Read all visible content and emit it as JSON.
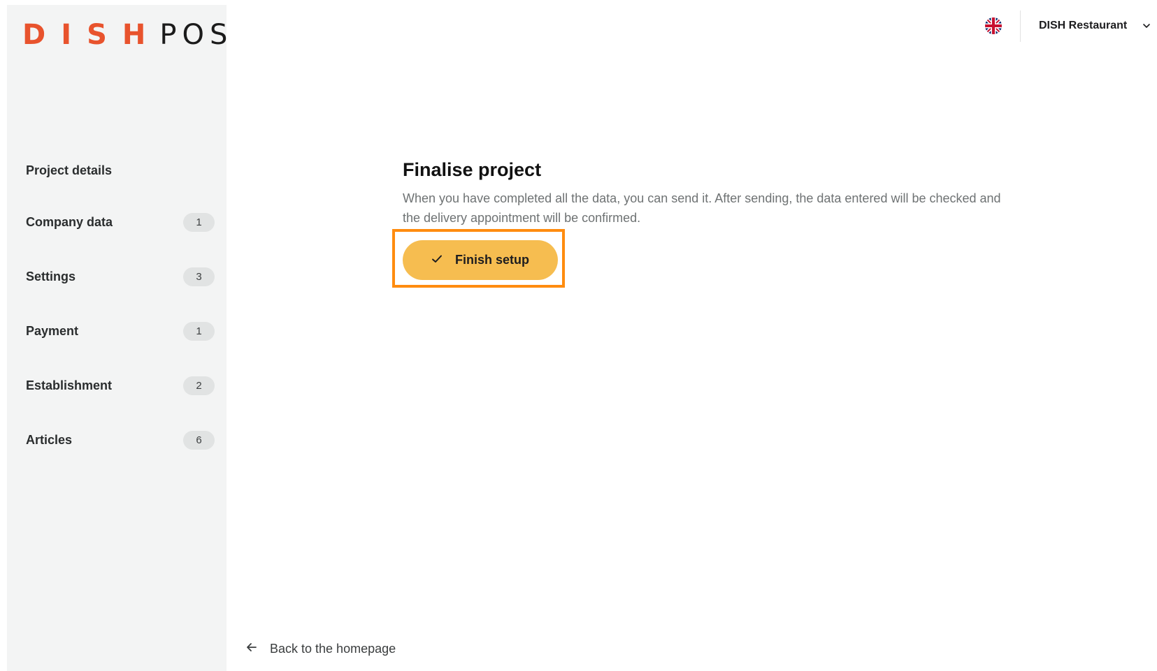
{
  "sidebar": {
    "logo": {
      "brand": "DISH",
      "product": "POS",
      "brand_color": "#e8532d"
    },
    "items": [
      {
        "label": "Project details",
        "badge": null
      },
      {
        "label": "Company data",
        "badge": "1"
      },
      {
        "label": "Settings",
        "badge": "3"
      },
      {
        "label": "Payment",
        "badge": "1"
      },
      {
        "label": "Establishment",
        "badge": "2"
      },
      {
        "label": "Articles",
        "badge": "6"
      }
    ]
  },
  "topbar": {
    "language_icon": "uk-flag-icon",
    "account_name": "DISH Restaurant",
    "account_icon": "chevron-down-icon"
  },
  "main": {
    "title": "Finalise project",
    "description": "When you have completed all the data, you can send it. After sending, the data entered will be checked and the delivery appointment will be confirmed.",
    "finish_button": {
      "label": "Finish setup",
      "icon": "check-icon",
      "color": "#f6bd50"
    },
    "highlight_color": "#ff8c0f"
  },
  "footer": {
    "back_link": {
      "label": "Back to the homepage",
      "icon": "arrow-left-icon"
    }
  }
}
